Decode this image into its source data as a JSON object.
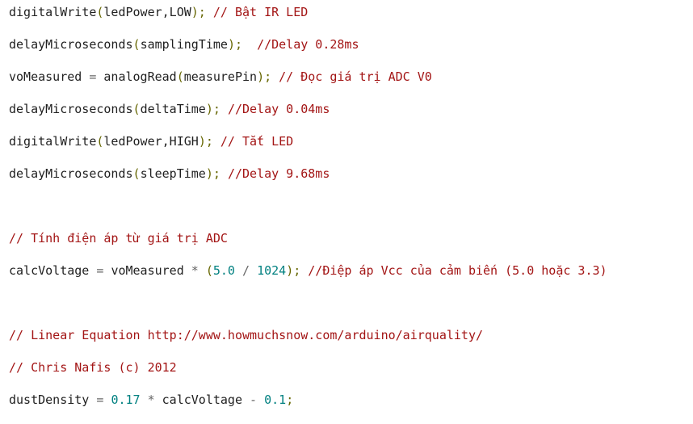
{
  "code": {
    "lines": [
      {
        "seg": [
          "digitalWrite",
          "(",
          "ledPower,LOW",
          ");",
          " ",
          "// Bật IR LED"
        ]
      },
      {
        "seg": [
          "delayMicroseconds",
          "(",
          "samplingTime",
          ");",
          "  ",
          "//Delay 0.28ms"
        ]
      },
      {
        "seg": [
          "voMeasured",
          " = ",
          "analogRead",
          "(",
          "measurePin",
          ");",
          " ",
          "// Đọc giá trị ADC V0"
        ]
      },
      {
        "seg": [
          "delayMicroseconds",
          "(",
          "deltaTime",
          ");",
          " ",
          "//Delay 0.04ms"
        ]
      },
      {
        "seg": [
          "digitalWrite",
          "(",
          "ledPower,HIGH",
          ");",
          " ",
          "// Tắt LED"
        ]
      },
      {
        "seg": [
          "delayMicroseconds",
          "(",
          "sleepTime",
          ");",
          " ",
          "//Delay 9.68ms"
        ]
      },
      {
        "seg": [
          ""
        ]
      },
      {
        "seg": [
          "// Tính điện áp từ giá trị ADC"
        ]
      },
      {
        "seg": [
          "calcVoltage",
          " = ",
          "voMeasured",
          " * ",
          "(",
          "5.0",
          " / ",
          "1024",
          ");",
          " ",
          "//Điệp áp Vcc của cảm biến (5.0 hoặc 3.3)"
        ]
      },
      {
        "seg": [
          ""
        ]
      },
      {
        "seg": [
          "// Linear Equation http://www.howmuchsnow.com/arduino/airquality/"
        ]
      },
      {
        "seg": [
          "// Chris Nafis (c) 2012"
        ]
      },
      {
        "seg": [
          "dustDensity",
          " = ",
          "0.17",
          " * ",
          "calcVoltage",
          " - ",
          "0.1",
          ";"
        ]
      }
    ]
  }
}
